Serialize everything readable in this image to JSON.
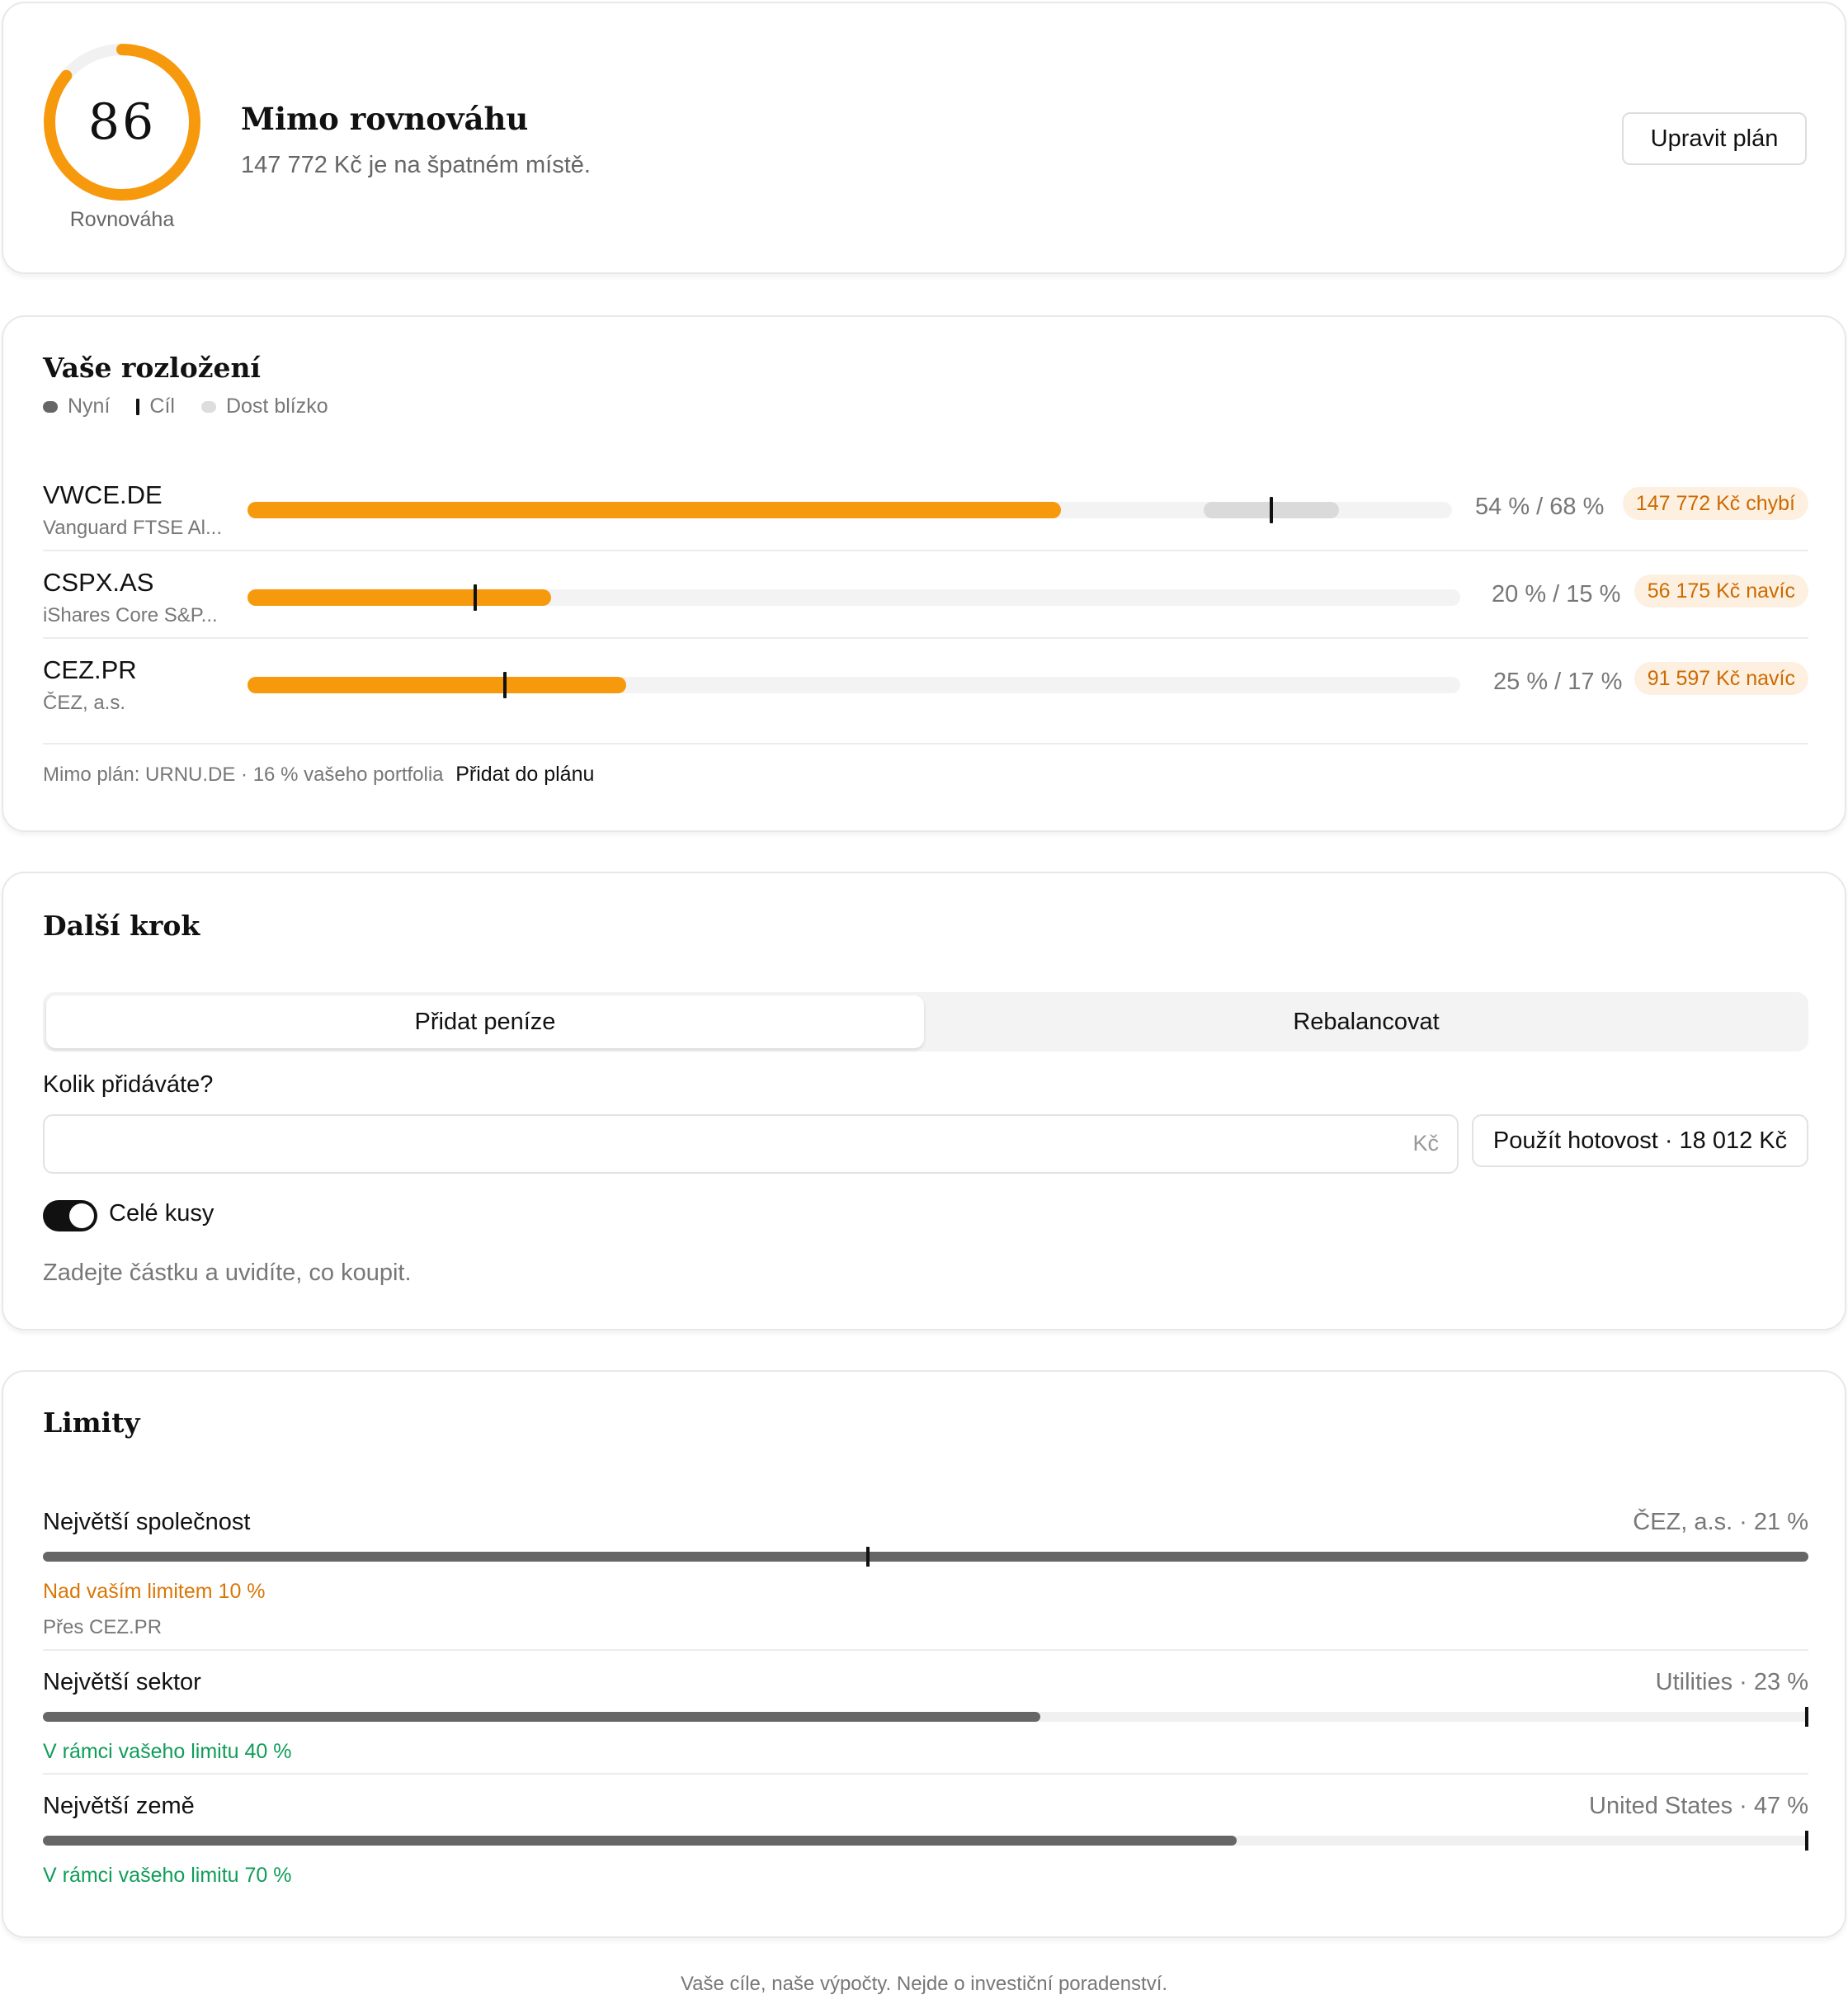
{
  "score": {
    "value": "86",
    "fraction": 0.86,
    "label": "Rovnováha",
    "title": "Mimo rovnováhu",
    "subtitle": "147 772 Kč je na špatném místě.",
    "edit_button": "Upravit plán"
  },
  "allocation": {
    "title": "Vaše rozložení",
    "legend": {
      "current": "Nyní",
      "target": "Cíl",
      "close": "Dost blízko"
    },
    "rows": [
      {
        "ticker": "VWCE.DE",
        "name": "Vanguard FTSE Al...",
        "current": 54,
        "target": 68,
        "band_low": 63.5,
        "band_high": 72.5,
        "pct_text": "54 % / 68 %",
        "badge": "147 772 Kč chybí"
      },
      {
        "ticker": "CSPX.AS",
        "name": "iShares Core S&P...",
        "current": 20,
        "target": 15,
        "pct_text": "20 % / 15 %",
        "badge": "56 175 Kč navíc"
      },
      {
        "ticker": "CEZ.PR",
        "name": "ČEZ, a.s.",
        "current": 25,
        "target": 17,
        "pct_text": "25 % / 17 %",
        "badge": "91 597 Kč navíc"
      }
    ],
    "off_plan_text": "Mimo plán: URNU.DE · 16 % vašeho portfolia",
    "off_plan_link": "Přidat do plánu"
  },
  "next_step": {
    "title": "Další krok",
    "tabs": [
      {
        "label": "Přidat peníze",
        "active": true
      },
      {
        "label": "Rebalancovat",
        "active": false
      }
    ],
    "amount_label": "Kolik přidáváte?",
    "amount_value": "",
    "currency": "Kč",
    "cash_button": "Použít hotovost · 18 012 Kč",
    "whole_units_label": "Celé kusy",
    "whole_units_on": true,
    "hint": "Zadejte částku a uvidíte, co koupit."
  },
  "limits": {
    "title": "Limity",
    "items": [
      {
        "label": "Největší společnost",
        "value": "ČEZ, a.s. · 21 %",
        "fill": 100,
        "limit": 46.8,
        "status": "Nad vaším limitem 10 %",
        "status_color": "#d97706",
        "sub": "Přes CEZ.PR"
      },
      {
        "label": "Největší sektor",
        "value": "Utilities · 23 %",
        "fill": 56.5,
        "limit": 100,
        "status": "V rámci vašeho limitu 40 %",
        "status_color": "#0f9d58",
        "sub": ""
      },
      {
        "label": "Největší země",
        "value": "United States · 47 %",
        "fill": 67.6,
        "limit": 100,
        "status": "V rámci vašeho limitu 70 %",
        "status_color": "#0f9d58",
        "sub": ""
      }
    ]
  },
  "footer": "Vaše cíle, naše výpočty. Nejde o investiční poradenství.",
  "colors": {
    "accent": "#f7990d",
    "badge_bg": "#fdf0e0",
    "badge_text": "#cc6a00",
    "ok": "#0f9d58",
    "warn": "#d97706"
  }
}
